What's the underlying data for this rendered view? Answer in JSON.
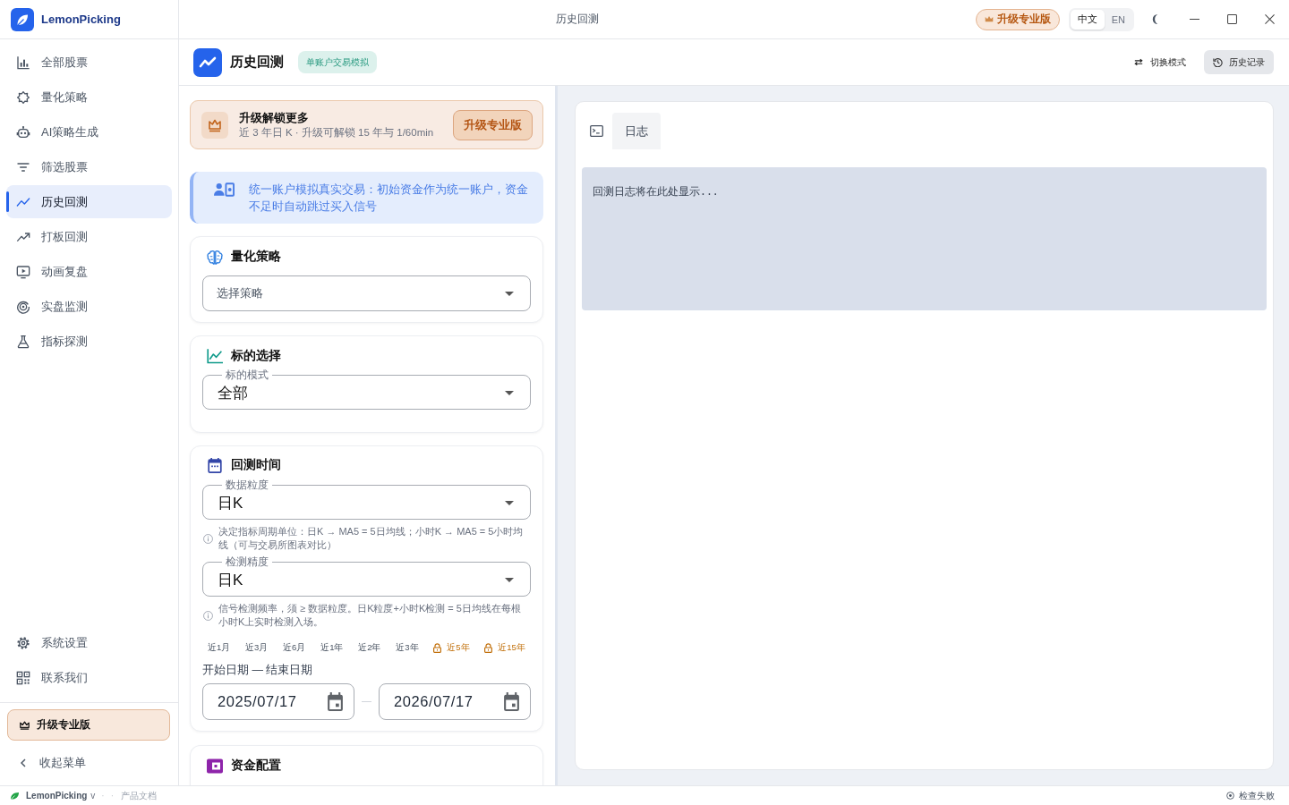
{
  "window": {
    "title": "历史回测"
  },
  "sidebar": {
    "brand": "LemonPicking",
    "items": [
      {
        "label": "全部股票",
        "selected": false
      },
      {
        "label": "量化策略",
        "selected": false
      },
      {
        "label": "AI策略生成",
        "selected": false
      },
      {
        "label": "筛选股票",
        "selected": false
      },
      {
        "label": "历史回测",
        "selected": true
      },
      {
        "label": "打板回测",
        "selected": false
      },
      {
        "label": "动画复盘",
        "selected": false
      },
      {
        "label": "实盘监测",
        "selected": false
      },
      {
        "label": "指标探测",
        "selected": false
      }
    ],
    "footer_items": [
      {
        "label": "系统设置"
      },
      {
        "label": "联系我们"
      }
    ],
    "upgrade": "升级专业版",
    "collapse": "收起菜单"
  },
  "topbar": {
    "upgrade": "升级专业版",
    "languages": [
      {
        "label": "中文",
        "selected": true
      },
      {
        "label": "EN",
        "selected": false
      }
    ]
  },
  "page_header": {
    "title": "历史回测",
    "badge": "单账户交易模拟",
    "switch_mode": "切换模式",
    "history": "历史记录"
  },
  "upgrade_card": {
    "title": "升级解锁更多",
    "subtitle": "近 3 年日 K · 升级可解锁 15 年与 1/60min",
    "button": "升级专业版"
  },
  "notice": "统一账户模拟真实交易：初始资金作为统一账户，资金不足时自动跳过买入信号",
  "strategy": {
    "title": "量化策略",
    "select": {
      "placeholder": "选择策略"
    }
  },
  "target": {
    "title": "标的选择",
    "select": {
      "label": "标的模式",
      "value": "全部"
    }
  },
  "time": {
    "title": "回测时间",
    "selects": [
      {
        "label": "数据粒度",
        "value": "日K",
        "hint": "决定指标周期单位：日K → MA5 = 5日均线；小时K → MA5 = 5小时均线（可与交易所图表对比）"
      },
      {
        "label": "检测精度",
        "value": "日K",
        "hint": "信号检测频率，须 ≥ 数据粒度。日K粒度+小时K检测 = 5日均线在每根小时K上实时检测入场。"
      }
    ],
    "quick_ranges": [
      {
        "label": "近1月",
        "locked": false
      },
      {
        "label": "近3月",
        "locked": false
      },
      {
        "label": "近6月",
        "locked": false
      },
      {
        "label": "近1年",
        "locked": false
      },
      {
        "label": "近2年",
        "locked": false
      },
      {
        "label": "近3年",
        "locked": false
      },
      {
        "label": "近5年",
        "locked": true
      },
      {
        "label": "近15年",
        "locked": true
      }
    ],
    "date_range_label": "开始日期 — 结束日期",
    "start_date": "2025/07/17",
    "end_date": "2026/07/17"
  },
  "capital": {
    "title": "资金配置"
  },
  "log_panel": {
    "tabs": [
      {
        "label": "日志",
        "selected": true
      }
    ],
    "placeholder": "回测日志将在此处显示..."
  },
  "status_bar": {
    "brand": "LemonPicking",
    "version": "v",
    "separators": [
      "·",
      "·"
    ],
    "docs": "产品文档",
    "status": "检查失败"
  }
}
